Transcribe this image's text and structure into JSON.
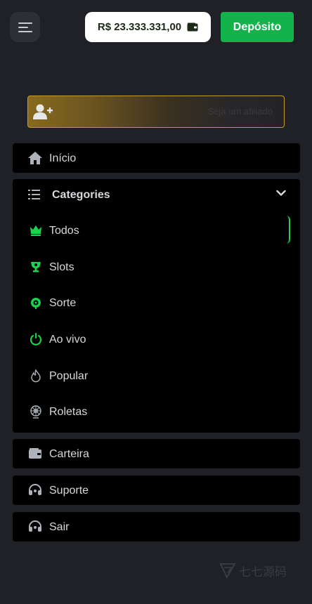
{
  "header": {
    "menu_icon": "hamburger-menu-icon",
    "balance": "R$ 23.333.331,00",
    "balance_icon": "wallet-icon",
    "deposit_label": "Depósito",
    "colors": {
      "deposit_bg": "#13b24a",
      "balance_bg": "#ffffff"
    }
  },
  "affiliate": {
    "label": "Seja um afiliado",
    "icon": "user-plus-icon",
    "border_color": "#c49a2a"
  },
  "nav": {
    "home": {
      "label": "Início",
      "icon": "home-icon"
    },
    "categories": {
      "label": "Categories",
      "icon": "list-icon",
      "expanded": true,
      "items": [
        {
          "label": "Todos",
          "icon": "crown-icon",
          "active": true
        },
        {
          "label": "Slots",
          "icon": "trophy-icon"
        },
        {
          "label": "Sorte",
          "icon": "clover-icon"
        },
        {
          "label": "Ao vivo",
          "icon": "power-icon"
        },
        {
          "label": "Popular",
          "icon": "flame-icon"
        },
        {
          "label": "Roletas",
          "icon": "roulette-icon"
        }
      ]
    },
    "wallet": {
      "label": "Carteira",
      "icon": "wallet-icon"
    },
    "support": {
      "label": "Suporte",
      "icon": "headset-icon"
    },
    "logout": {
      "label": "Sair",
      "icon": "headset-icon"
    }
  },
  "watermark": {
    "text": "七七源码",
    "icon": "logo-mark-icon"
  },
  "colors": {
    "accent_green": "#19d34c",
    "page_bg": "#1f2126",
    "panel_bg": "#000000"
  }
}
